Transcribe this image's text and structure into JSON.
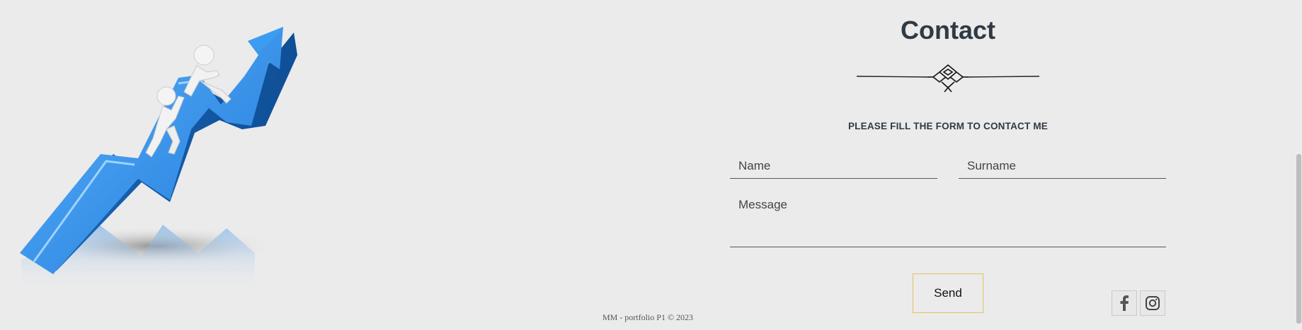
{
  "contact": {
    "title": "Contact",
    "subtitle": "PLEASE FILL THE FORM TO CONTACT ME"
  },
  "form": {
    "name_placeholder": "Name",
    "surname_placeholder": "Surname",
    "message_placeholder": "Message",
    "send_label": "Send"
  },
  "social": {
    "facebook_icon": "facebook-icon",
    "instagram_icon": "instagram-icon"
  },
  "footer": {
    "text": "MM - portfolio P1 © 2023"
  },
  "colors": {
    "background": "#ebebeb",
    "heading": "#2f3a44",
    "button_border": "#e3c25a",
    "arrow_blue": "#2f8de4"
  }
}
